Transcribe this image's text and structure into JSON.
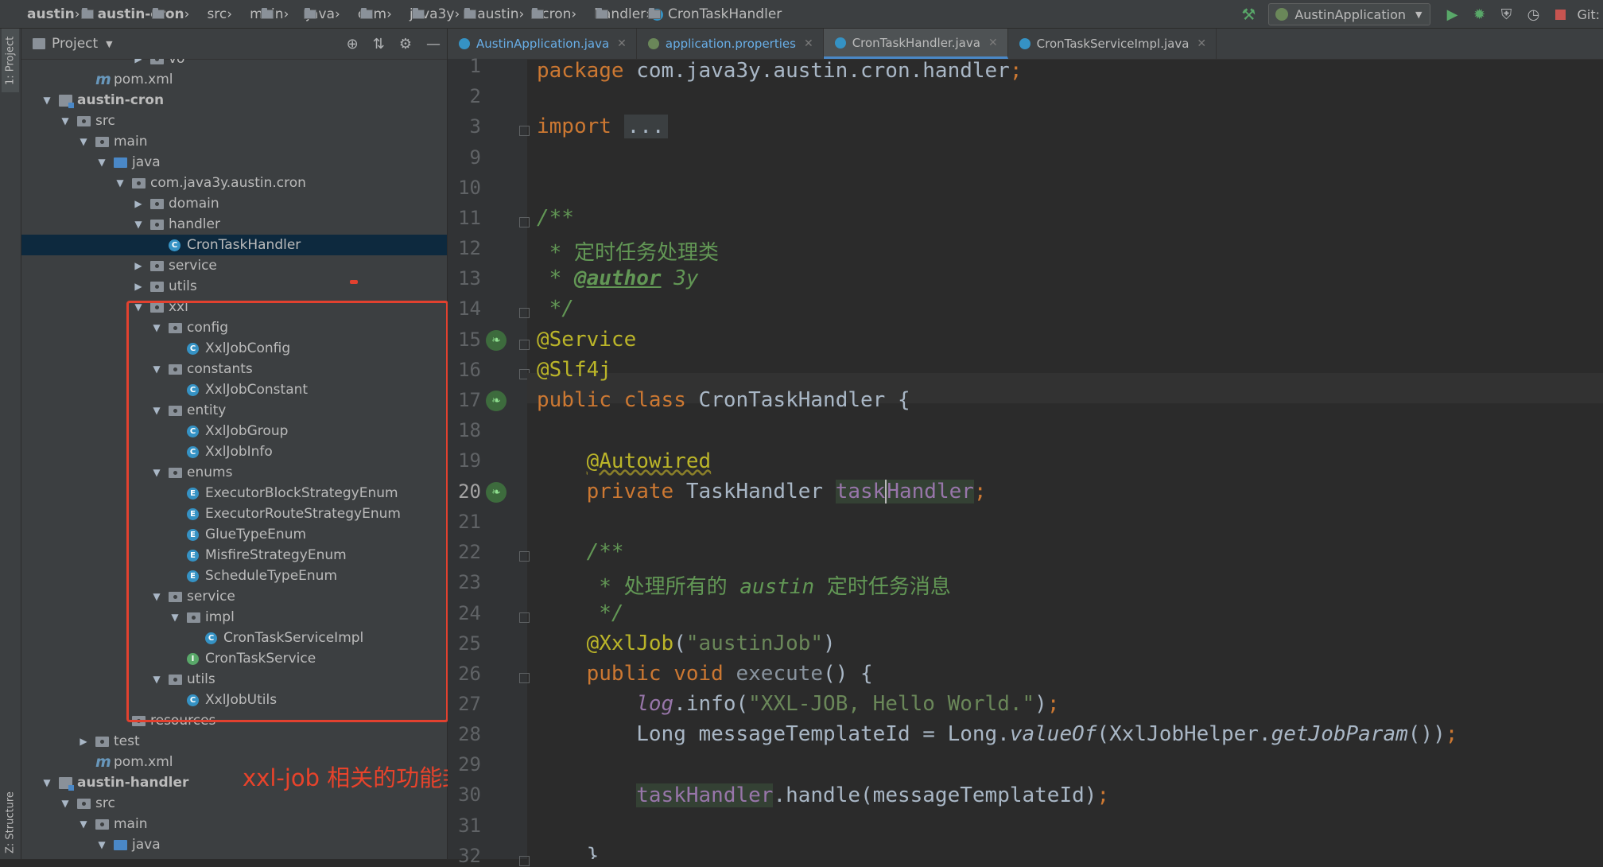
{
  "breadcrumbs": [
    "austin",
    "austin-cron",
    "src",
    "main",
    "java",
    "com",
    "java3y",
    "austin",
    "cron",
    "handler",
    "CronTaskHandler"
  ],
  "toolbar": {
    "run_config": "AustinApplication",
    "git_label": "Git:"
  },
  "side_tabs": {
    "project": "1: Project",
    "structure": "Z: Structure"
  },
  "project_panel": {
    "title": "Project",
    "tree": [
      {
        "label": "vo",
        "type": "folder",
        "arrow": "collapsed"
      },
      {
        "label": "pom.xml",
        "type": "maven"
      },
      {
        "label": "austin-cron",
        "type": "module",
        "arrow": "expanded",
        "bold": true
      },
      {
        "label": "src",
        "type": "folder",
        "arrow": "expanded"
      },
      {
        "label": "main",
        "type": "folder",
        "arrow": "expanded"
      },
      {
        "label": "java",
        "type": "src",
        "arrow": "expanded"
      },
      {
        "label": "com.java3y.austin.cron",
        "type": "package",
        "arrow": "expanded"
      },
      {
        "label": "domain",
        "type": "package",
        "arrow": "collapsed"
      },
      {
        "label": "handler",
        "type": "package",
        "arrow": "expanded"
      },
      {
        "label": "CronTaskHandler",
        "type": "class",
        "selected": true
      },
      {
        "label": "service",
        "type": "package",
        "arrow": "collapsed"
      },
      {
        "label": "utils",
        "type": "package",
        "arrow": "collapsed"
      },
      {
        "label": "xxl",
        "type": "package",
        "arrow": "expanded"
      },
      {
        "label": "config",
        "type": "package",
        "arrow": "expanded"
      },
      {
        "label": "XxlJobConfig",
        "type": "class"
      },
      {
        "label": "constants",
        "type": "package",
        "arrow": "expanded"
      },
      {
        "label": "XxlJobConstant",
        "type": "class"
      },
      {
        "label": "entity",
        "type": "package",
        "arrow": "expanded"
      },
      {
        "label": "XxlJobGroup",
        "type": "class"
      },
      {
        "label": "XxlJobInfo",
        "type": "class"
      },
      {
        "label": "enums",
        "type": "package",
        "arrow": "expanded"
      },
      {
        "label": "ExecutorBlockStrategyEnum",
        "type": "enum"
      },
      {
        "label": "ExecutorRouteStrategyEnum",
        "type": "enum"
      },
      {
        "label": "GlueTypeEnum",
        "type": "enum"
      },
      {
        "label": "MisfireStrategyEnum",
        "type": "enum"
      },
      {
        "label": "ScheduleTypeEnum",
        "type": "enum"
      },
      {
        "label": "service",
        "type": "package",
        "arrow": "expanded"
      },
      {
        "label": "impl",
        "type": "package",
        "arrow": "expanded"
      },
      {
        "label": "CronTaskServiceImpl",
        "type": "class"
      },
      {
        "label": "CronTaskService",
        "type": "interface"
      },
      {
        "label": "utils",
        "type": "package",
        "arrow": "expanded"
      },
      {
        "label": "XxlJobUtils",
        "type": "class"
      },
      {
        "label": "resources",
        "type": "folder"
      },
      {
        "label": "test",
        "type": "folder",
        "arrow": "collapsed"
      },
      {
        "label": "pom.xml",
        "type": "maven"
      },
      {
        "label": "austin-handler",
        "type": "module",
        "arrow": "expanded",
        "bold": true
      },
      {
        "label": "src",
        "type": "folder",
        "arrow": "expanded"
      },
      {
        "label": "main",
        "type": "folder",
        "arrow": "expanded"
      },
      {
        "label": "java",
        "type": "src",
        "arrow": "expanded"
      }
    ]
  },
  "annotation": "xxl-job 相关的功能封装",
  "editor_tabs": [
    {
      "label": "AustinApplication.java",
      "icon": "class-icon",
      "blue": true
    },
    {
      "label": "application.properties",
      "icon": "spring-leaf-icon",
      "blue": true
    },
    {
      "label": "CronTaskHandler.java",
      "icon": "class-icon",
      "active": true
    },
    {
      "label": "CronTaskServiceImpl.java",
      "icon": "class-icon"
    }
  ],
  "code": {
    "line_numbers": [
      "1",
      "2",
      "3",
      "9",
      "10",
      "11",
      "12",
      "13",
      "14",
      "15",
      "16",
      "17",
      "18",
      "19",
      "20",
      "21",
      "22",
      "23",
      "24",
      "25",
      "26",
      "27",
      "28",
      "29",
      "30",
      "31",
      "32"
    ],
    "current_line": "20",
    "tokens": {
      "package_kw": "package",
      "package_name": " com.java3y.austin.cron.handler",
      "semi": ";",
      "import_kw": "import",
      "import_ellipsis": "...",
      "javadoc_open": "/**",
      "javadoc_desc": " * 定时任务处理类",
      "javadoc_star": " * ",
      "author_tag": "@author",
      "author_val": " 3y",
      "javadoc_close": " */",
      "ann_service": "@Service",
      "ann_slf4j": "@Slf4j",
      "public_kw": "public",
      "class_kw": "class",
      "class_name": "CronTaskHandler",
      "open_brace": " {",
      "ann_autowired": "@Autowired",
      "private_kw": "private",
      "field_type": "TaskHandler",
      "field_name_pre": "task",
      "field_name_post": "Handler",
      "method_doc_open": "/**",
      "method_doc_pre": " * 处理所有的 ",
      "method_doc_austin": "austin",
      "method_doc_post": " 定时任务消息",
      "method_doc_close": " */",
      "ann_xxljob": "@XxlJob",
      "xxljob_arg": "\"austinJob\"",
      "void_kw": "void",
      "method_name": "execute",
      "log_obj": "log",
      "log_call": ".info(",
      "log_str": "\"XXL-JOB, Hello World.\"",
      "log_end": ")",
      "long_decl": "Long messageTemplateId = Long.",
      "value_of": "valueOf",
      "helper": "(XxlJobHelper.",
      "get_param": "getJobParam",
      "helper_end": "())",
      "handle_call": ".handle(messageTemplateId)",
      "close_brace": "}"
    }
  }
}
